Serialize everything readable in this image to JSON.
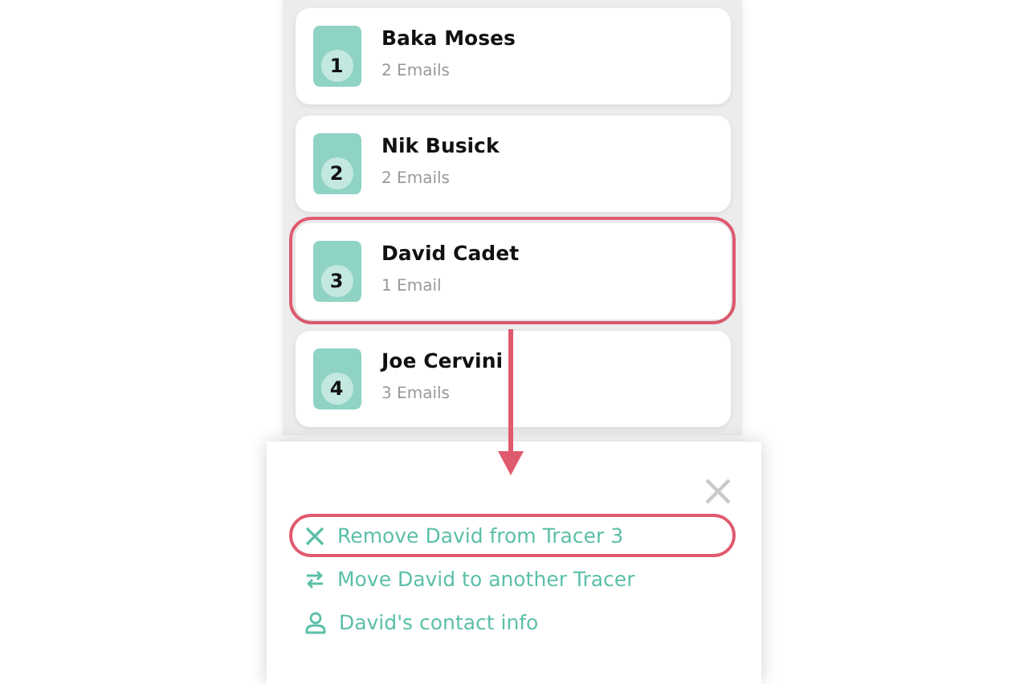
{
  "contacts": [
    {
      "number": "1",
      "name": "Baka Moses",
      "emails": "2 Emails",
      "highlighted": false
    },
    {
      "number": "2",
      "name": "Nik Busick",
      "emails": "2 Emails",
      "highlighted": false
    },
    {
      "number": "3",
      "name": "David Cadet",
      "emails": "1 Email",
      "highlighted": true
    },
    {
      "number": "4",
      "name": "Joe Cervini",
      "emails": "3 Emails",
      "highlighted": false
    }
  ],
  "actions": [
    {
      "kind": "remove",
      "label": "Remove David from Tracer 3",
      "highlighted": true
    },
    {
      "kind": "move",
      "label": "Move David to another Tracer",
      "highlighted": false
    },
    {
      "kind": "contact",
      "label": "David's contact info",
      "highlighted": false
    }
  ]
}
